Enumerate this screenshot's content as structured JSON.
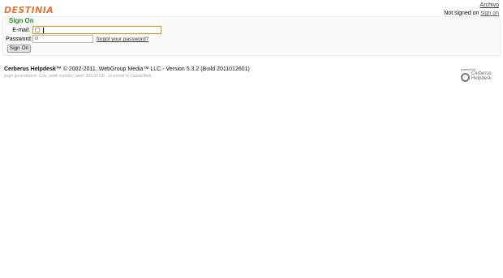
{
  "header": {
    "logo_text": "DESTINIA",
    "archivo_link": "Archivo",
    "signin_status_prefix": "Not signed on",
    "signin_link": "sign on"
  },
  "signon": {
    "title": "Sign On",
    "email_label": "E-mail:",
    "email_value": "",
    "password_label": "Password:",
    "password_value": "",
    "forgot_link": "forgot your password?",
    "button_label": "Sign On"
  },
  "footer": {
    "product": "Cerberus Helpdesk™",
    "copyright": "© 2002-2011, WebGroup Media™ LLC - Version 5.3.2 (Build 2011012601)",
    "stats": "page generated in: 0.0s; peak memory used: 993.00 KB  -  Licensed to ClassicWeb",
    "powered_by": "powered by",
    "logo_line1": "Cerberus",
    "logo_line2": "Helpdesk"
  },
  "colors": {
    "brand": "#e2773a",
    "title_green": "#2b8a2b",
    "focus_border": "#d2a030"
  }
}
